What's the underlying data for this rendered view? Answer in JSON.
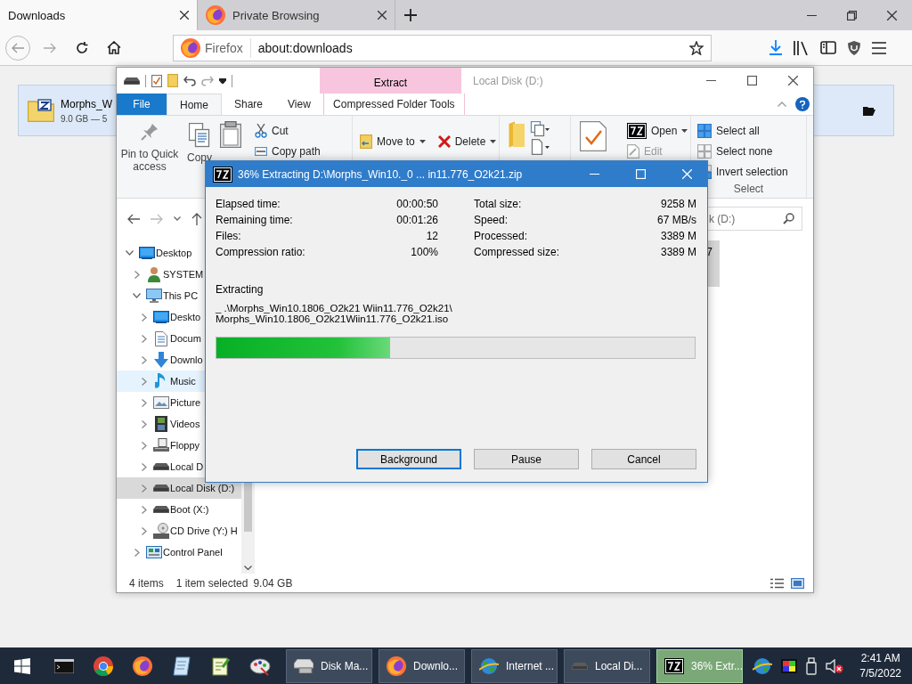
{
  "browser": {
    "tabs": [
      {
        "label": "Downloads",
        "kind": "page",
        "selected": true
      },
      {
        "label": "Private Browsing",
        "kind": "private",
        "selected": false
      }
    ],
    "url_bar": {
      "identity": "Firefox",
      "value": "about:downloads"
    },
    "downloads": [
      {
        "name": "Morphs_W",
        "details": "9.0 GB — 5"
      }
    ]
  },
  "explorer": {
    "title": "Local Disk (D:)",
    "context_tab": "Extract",
    "ribbon_tabs": [
      {
        "label": "File",
        "kind": "file",
        "selected": false
      },
      {
        "label": "Home",
        "kind": "tab",
        "selected": true
      },
      {
        "label": "Share",
        "kind": "tab",
        "selected": false
      },
      {
        "label": "View",
        "kind": "tab",
        "selected": false
      },
      {
        "label": "Compressed Folder Tools",
        "kind": "context",
        "selected": false
      }
    ],
    "ribbon": {
      "pin": "Pin to Quick access",
      "copy": "Copy",
      "cut": "Cut",
      "copy_path": "Copy path",
      "move_to": "Move to",
      "delete": "Delete",
      "open": "Open",
      "edit": {
        "label": "Edit",
        "disabled": true
      },
      "select_all": "Select all",
      "select_none": "Select none",
      "invert_selection": "Invert selection",
      "select_group": "Select"
    },
    "search": {
      "placeholder": "k (D:)"
    },
    "tree": [
      {
        "label": "Desktop",
        "kind": "desktop",
        "expanded": true,
        "selected": false,
        "hovered": false,
        "children": [
          {
            "label": "SYSTEM",
            "kind": "user",
            "expanded": false,
            "selected": false,
            "hovered": false
          },
          {
            "label": "This PC",
            "kind": "pc",
            "expanded": true,
            "selected": false,
            "hovered": false,
            "children": [
              {
                "label": "Deskto",
                "kind": "desktop",
                "expanded": false,
                "selected": false,
                "hovered": false
              },
              {
                "label": "Docum",
                "kind": "document",
                "expanded": false,
                "selected": false,
                "hovered": false
              },
              {
                "label": "Downlo",
                "kind": "download",
                "expanded": false,
                "selected": false,
                "hovered": false
              },
              {
                "label": "Music",
                "kind": "music",
                "expanded": false,
                "selected": false,
                "hovered": true
              },
              {
                "label": "Picture",
                "kind": "picture",
                "expanded": false,
                "selected": false,
                "hovered": false
              },
              {
                "label": "Videos",
                "kind": "video",
                "expanded": false,
                "selected": false,
                "hovered": false
              },
              {
                "label": "Floppy",
                "kind": "floppy",
                "expanded": false,
                "selected": false,
                "hovered": false
              },
              {
                "label": "Local D",
                "kind": "drive",
                "expanded": false,
                "selected": false,
                "hovered": false
              },
              {
                "label": "Local Disk (D:)",
                "kind": "drive",
                "expanded": false,
                "selected": true,
                "hovered": false
              },
              {
                "label": "Boot (X:)",
                "kind": "drive",
                "expanded": false,
                "selected": false,
                "hovered": false
              },
              {
                "label": "CD Drive (Y:) H",
                "kind": "cd",
                "expanded": false,
                "selected": false,
                "hovered": false
              }
            ]
          },
          {
            "label": "Control Panel",
            "kind": "control",
            "expanded": false,
            "selected": false,
            "hovered": false
          }
        ]
      }
    ],
    "files": [
      {
        "label": "7",
        "selected": true
      }
    ],
    "status": {
      "count": "4 items",
      "selection": "1 item selected",
      "size": "9.04 GB"
    }
  },
  "dialog": {
    "title": "36% Extracting D:\\Morphs_Win10._0 ... in11.776_O2k21.zip",
    "stats_left": [
      {
        "label": "Elapsed time:",
        "value": "00:00:50"
      },
      {
        "label": "Remaining time:",
        "value": "00:01:26"
      },
      {
        "label": "Files:",
        "value": "12"
      },
      {
        "label": "Compression ratio:",
        "value": "100%"
      }
    ],
    "stats_right": [
      {
        "label": "Total size:",
        "value": "9258 M"
      },
      {
        "label": "Speed:",
        "value": "67 MB/s"
      },
      {
        "label": "Processed:",
        "value": "3389 M"
      },
      {
        "label": "Compressed size:",
        "value": "3389 M"
      }
    ],
    "status": "Extracting",
    "path": [
      "_ .\\Morphs_Win10.1806_O2k21 Wiin11.776_O2k21\\",
      "Morphs_Win10.1806_O2k21Wiin11.776_O2k21.iso"
    ],
    "level": 0.364,
    "buttons": [
      {
        "label": "Background",
        "focused": true
      },
      {
        "label": "Pause",
        "focused": false
      },
      {
        "label": "Cancel",
        "focused": false
      }
    ]
  },
  "taskbar": {
    "pinned": [
      {
        "kind": "terminal"
      },
      {
        "kind": "chrome"
      },
      {
        "kind": "firefox"
      },
      {
        "kind": "notepad"
      },
      {
        "kind": "editor"
      },
      {
        "kind": "paint"
      }
    ],
    "buttons": [
      {
        "label": "Disk Ma...",
        "kind": "disks",
        "progress": false
      },
      {
        "label": "Downlo...",
        "kind": "firefox",
        "progress": false
      },
      {
        "label": "Internet ...",
        "kind": "globe",
        "progress": false
      },
      {
        "label": "Local Di...",
        "kind": "drive",
        "progress": false
      },
      {
        "label": "36% Extr...",
        "kind": "sevenzip",
        "progress": true
      }
    ],
    "tray": [
      {
        "kind": "globe"
      },
      {
        "kind": "colors"
      },
      {
        "kind": "usb"
      },
      {
        "kind": "muted"
      }
    ],
    "clock": {
      "time": "2:41 AM",
      "date": "7/5/2022"
    }
  }
}
